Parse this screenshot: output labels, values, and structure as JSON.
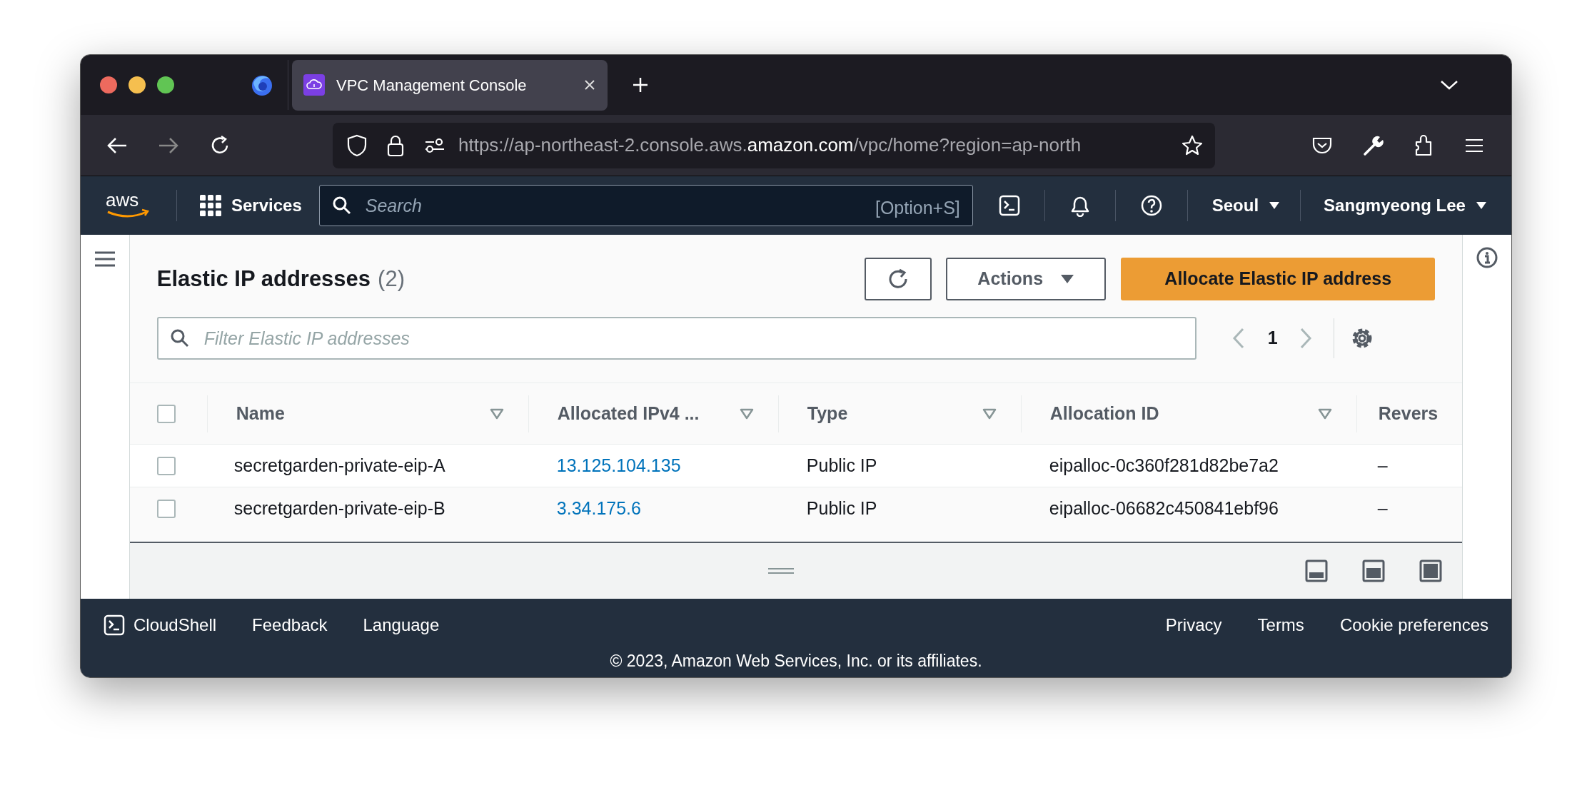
{
  "browser": {
    "tab": {
      "title": "VPC Management Console",
      "selected": true
    },
    "url": {
      "scheme_host": "https://ap-northeast-2.console.aws.",
      "domain": "amazon.com",
      "path": "/vpc/home?region=ap-north"
    }
  },
  "aws_nav": {
    "logo": "aws",
    "services": "Services",
    "search_placeholder": "Search",
    "shortcut": "[Option+S]",
    "region": "Seoul",
    "user": "Sangmyeong Lee"
  },
  "page": {
    "title": "Elastic IP addresses",
    "count": "(2)",
    "actions": "Actions",
    "allocate": "Allocate Elastic IP address",
    "filter_placeholder": "Filter Elastic IP addresses",
    "page_number": "1"
  },
  "table": {
    "header_checked": false,
    "columns": [
      {
        "label": "Name",
        "filter": true
      },
      {
        "label": "Allocated IPv4 ...",
        "filter": true
      },
      {
        "label": "Type",
        "filter": true
      },
      {
        "label": "Allocation ID",
        "filter": true
      },
      {
        "label": "Revers"
      }
    ],
    "rows": [
      {
        "checked": false,
        "name": "secretgarden-private-eip-A",
        "ip": "13.125.104.135",
        "type": "Public IP",
        "allocation_id": "eipalloc-0c360f281d82be7a2",
        "reverse": "–"
      },
      {
        "checked": false,
        "name": "secretgarden-private-eip-B",
        "ip": "3.34.175.6",
        "type": "Public IP",
        "allocation_id": "eipalloc-06682c450841ebf96",
        "reverse": "–"
      }
    ]
  },
  "footer": {
    "left": [
      "CloudShell",
      "Feedback",
      "Language"
    ],
    "right": [
      "Privacy",
      "Terms",
      "Cookie preferences"
    ],
    "copyright": "© 2023, Amazon Web Services, Inc. or its affiliates."
  }
}
